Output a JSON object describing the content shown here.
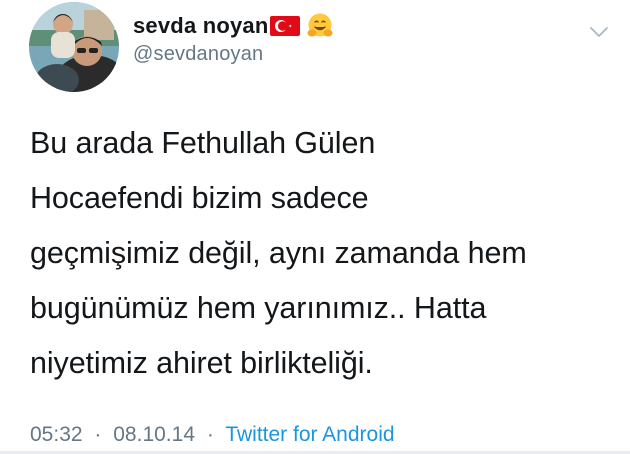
{
  "tweet": {
    "display_name": "sevda noyan",
    "handle": "@sevdanoyan",
    "text_lines": [
      "Bu arada Fethullah Gülen",
      "Hocaefendi bizim sadece",
      "geçmişimiz değil, aynı zamanda hem",
      "bugünümüz hem yarınımız.. Hatta",
      "niyetimiz ahiret birlikteliği."
    ],
    "time": "05:32",
    "separator": "·",
    "date": "08.10.14",
    "source": "Twitter for Android"
  },
  "icons": {
    "flag": "turkey-flag-icon",
    "emoji": "hugging-face-icon",
    "menu": "chevron-down-icon"
  },
  "colors": {
    "name": "#14171a",
    "secondary": "#657786",
    "link": "#1b95e0",
    "flag_red": "#e30a17"
  }
}
